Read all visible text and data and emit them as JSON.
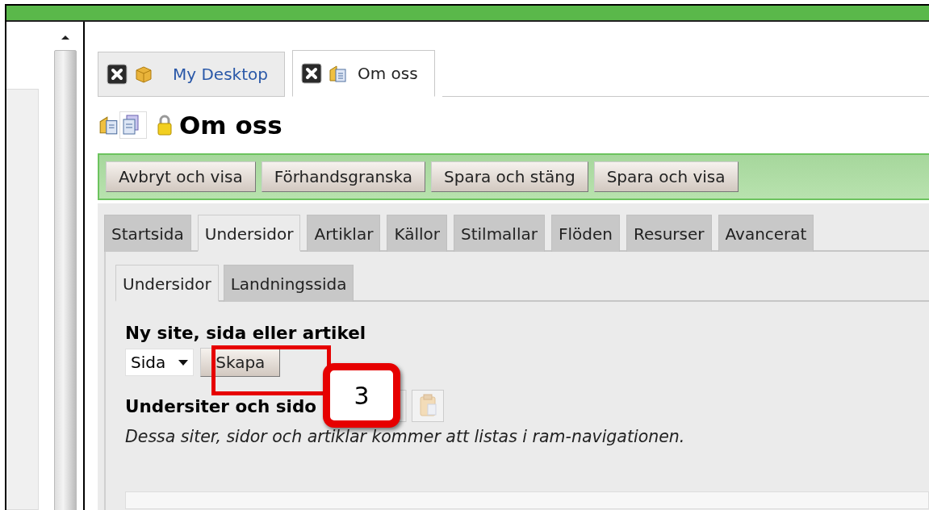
{
  "desktop_tabs": [
    {
      "label": "My Desktop",
      "selected": false
    },
    {
      "label": "Om oss",
      "selected": true
    }
  ],
  "page": {
    "title": "Om oss",
    "locked": true
  },
  "toolbar_buttons": [
    "Avbryt och visa",
    "Förhandsgranska",
    "Spara och stäng",
    "Spara och visa"
  ],
  "tabs": [
    {
      "label": "Startsida",
      "selected": false
    },
    {
      "label": "Undersidor",
      "selected": true
    },
    {
      "label": "Artiklar",
      "selected": false
    },
    {
      "label": "Källor",
      "selected": false
    },
    {
      "label": "Stilmallar",
      "selected": false
    },
    {
      "label": "Flöden",
      "selected": false
    },
    {
      "label": "Resurser",
      "selected": false
    },
    {
      "label": "Avancerat",
      "selected": false
    }
  ],
  "subtabs": [
    {
      "label": "Undersidor",
      "selected": true
    },
    {
      "label": "Landningssida",
      "selected": false
    }
  ],
  "new_item": {
    "heading": "Ny site, sida eller artikel",
    "type_select": "Sida",
    "button": "Skapa"
  },
  "subpages": {
    "heading": "Undersiter och sido",
    "description": "Dessa siter, sidor och artiklar kommer att listas i ram-navigationen."
  },
  "callout": {
    "number": "3"
  }
}
